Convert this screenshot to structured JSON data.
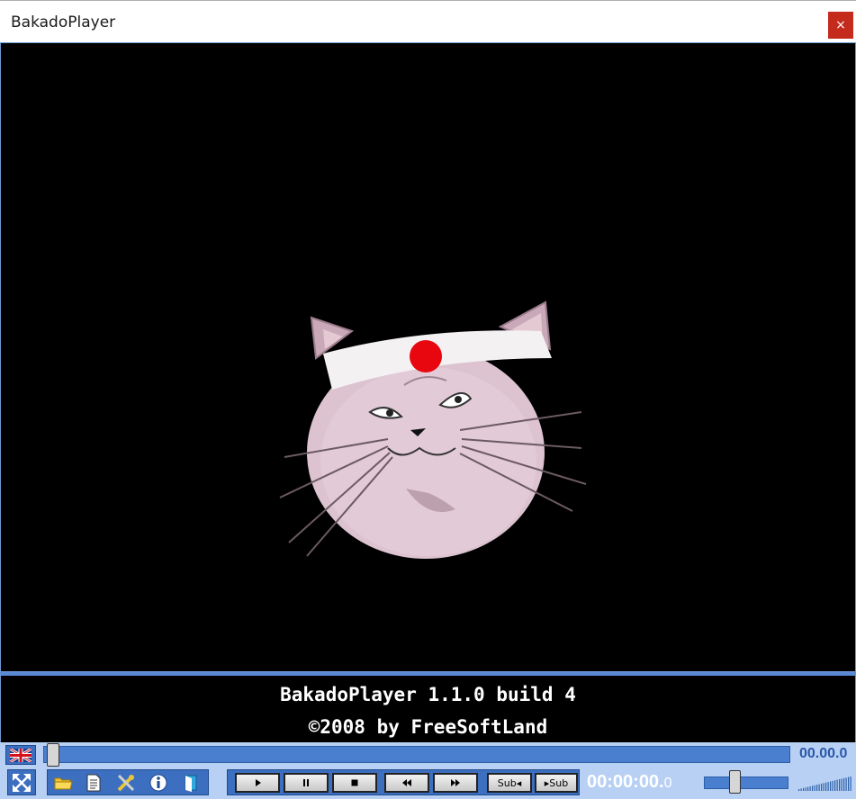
{
  "window": {
    "title": "BakadoPlayer",
    "close_label": "×"
  },
  "info": {
    "line1": "BakadoPlayer 1.1.0 build 4",
    "line2": "©2008 by FreeSoftLand"
  },
  "seek": {
    "total_time": "00.00.0",
    "position": 0
  },
  "transport": {
    "sub_prev_label": "Sub◂",
    "sub_next_label": "▸Sub"
  },
  "time": {
    "current_main": "00:00:00.",
    "current_frac": "0"
  },
  "volume": {
    "level": 0.3
  },
  "icons": {
    "language": "uk-flag-icon",
    "fullscreen": "fullscreen-arrows-icon",
    "open": "folder-icon",
    "playlist": "document-icon",
    "settings": "tools-icon",
    "info": "info-icon",
    "skin": "skin-icon"
  },
  "colors": {
    "accent": "#3d6fc0",
    "panel": "#b8d0f4",
    "close": "#c42b1c"
  }
}
